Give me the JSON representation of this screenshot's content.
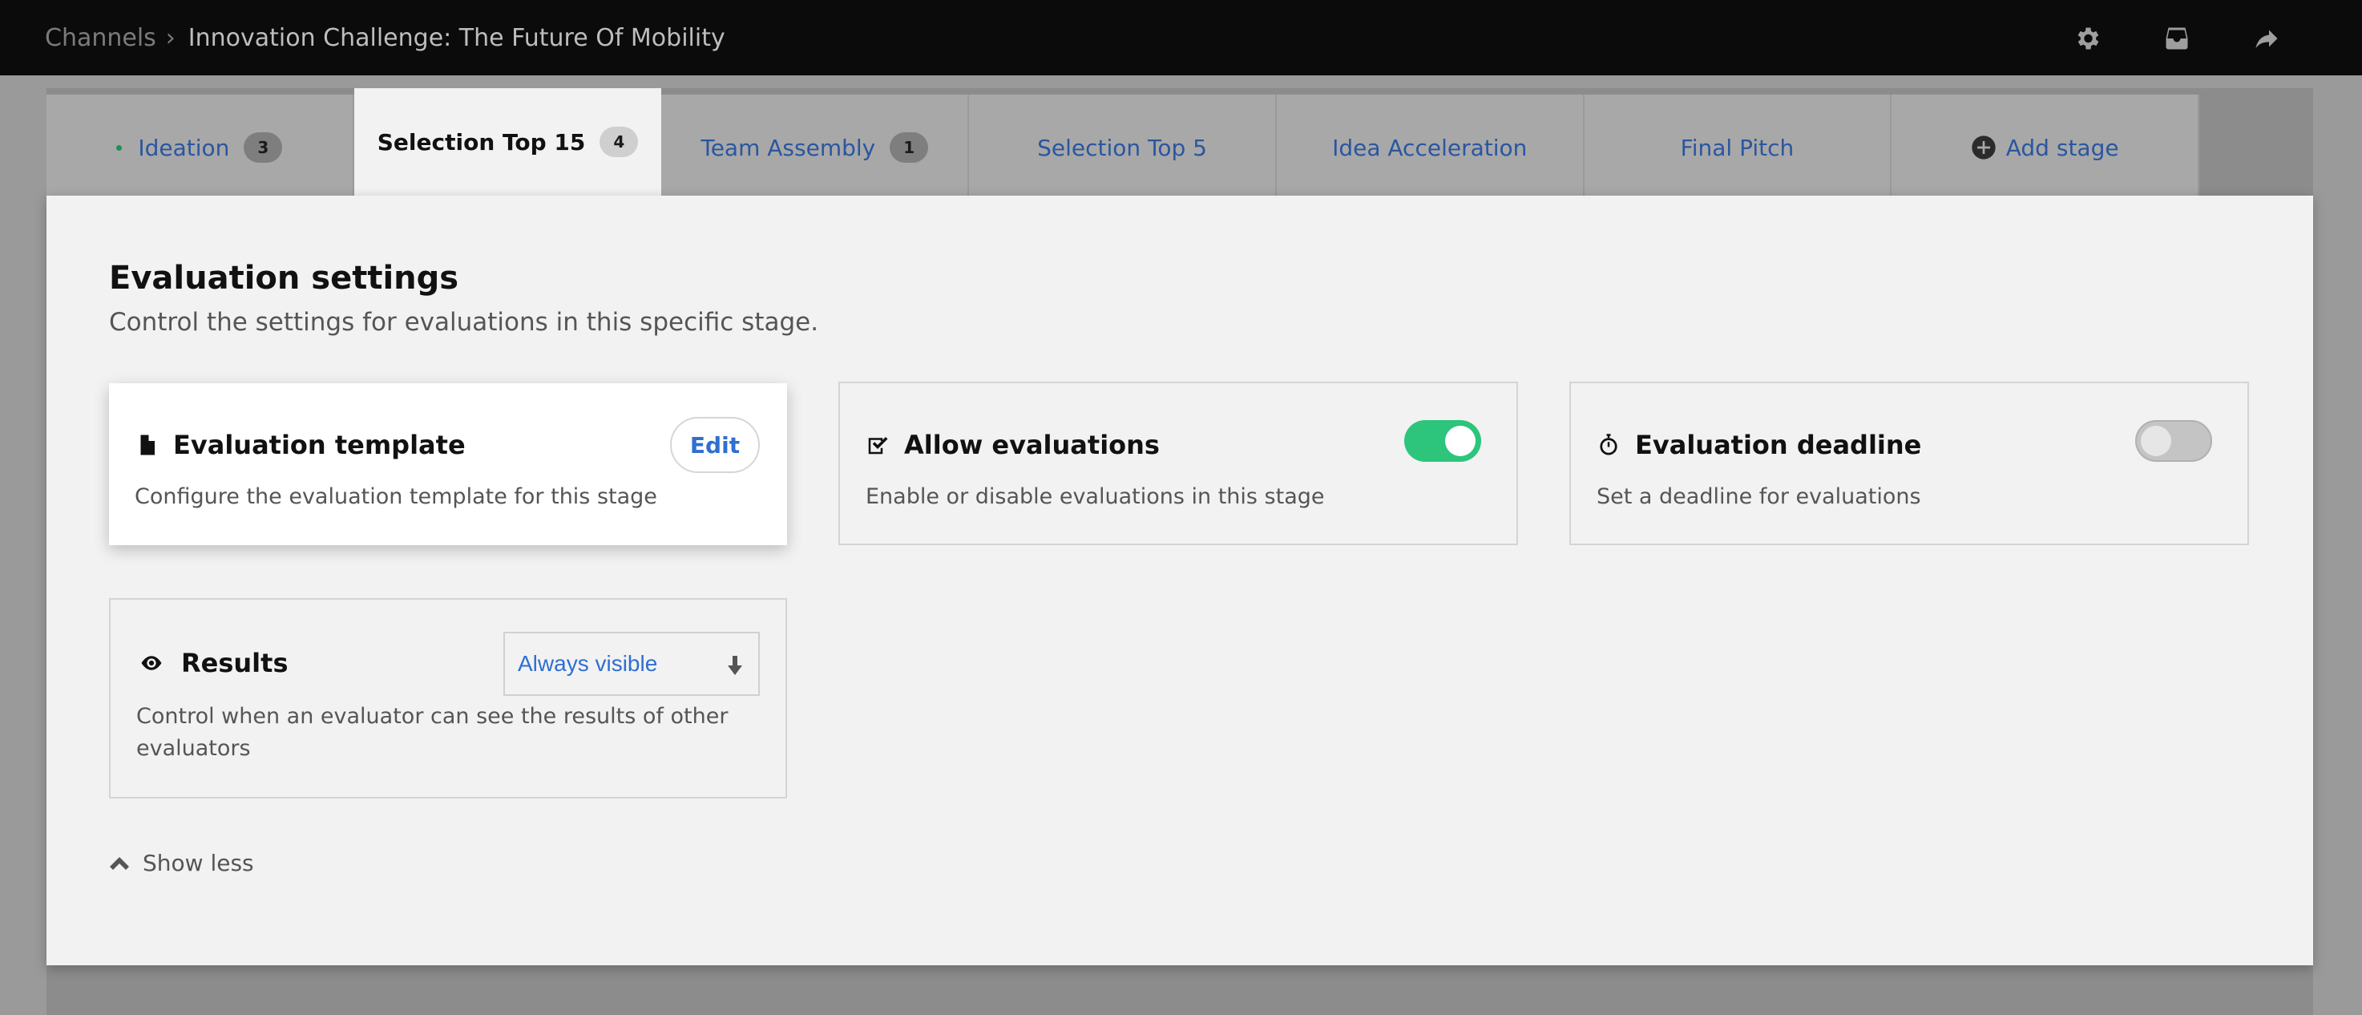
{
  "breadcrumb": {
    "root": "Channels",
    "separator": "›",
    "current": "Innovation Challenge: The Future Of Mobility"
  },
  "topbar_icons": [
    "gear-icon",
    "inbox-icon",
    "share-icon"
  ],
  "tabs": [
    {
      "label": "Ideation",
      "badge": "3",
      "status_dot": true
    },
    {
      "label": "Selection Top 15",
      "badge": "4",
      "active": true
    },
    {
      "label": "Team Assembly",
      "badge": "1"
    },
    {
      "label": "Selection Top 5"
    },
    {
      "label": "Idea Acceleration"
    },
    {
      "label": "Final Pitch"
    },
    {
      "label": "Add stage",
      "icon": "plus-circle-icon"
    }
  ],
  "panel": {
    "title": "Evaluation settings",
    "subtitle": "Control the settings for evaluations in this specific stage."
  },
  "cards": {
    "template": {
      "title": "Evaluation template",
      "desc": "Configure the evaluation template for this stage",
      "button": "Edit",
      "icon": "document-icon"
    },
    "allow": {
      "title": "Allow evaluations",
      "desc": "Enable or disable evaluations in this stage",
      "enabled": true,
      "icon": "checkbox-icon"
    },
    "deadline": {
      "title": "Evaluation deadline",
      "desc": "Set a deadline for evaluations",
      "enabled": false,
      "icon": "stopwatch-icon"
    },
    "results": {
      "title": "Results",
      "desc": "Control when an evaluator can see the results of other evaluators",
      "select_value": "Always visible",
      "icon": "eye-icon"
    }
  },
  "show_less": "Show less",
  "colors": {
    "accent_blue": "#2f6fd1",
    "toggle_on": "#2cc57b",
    "topbar": "#0b0b0b"
  }
}
